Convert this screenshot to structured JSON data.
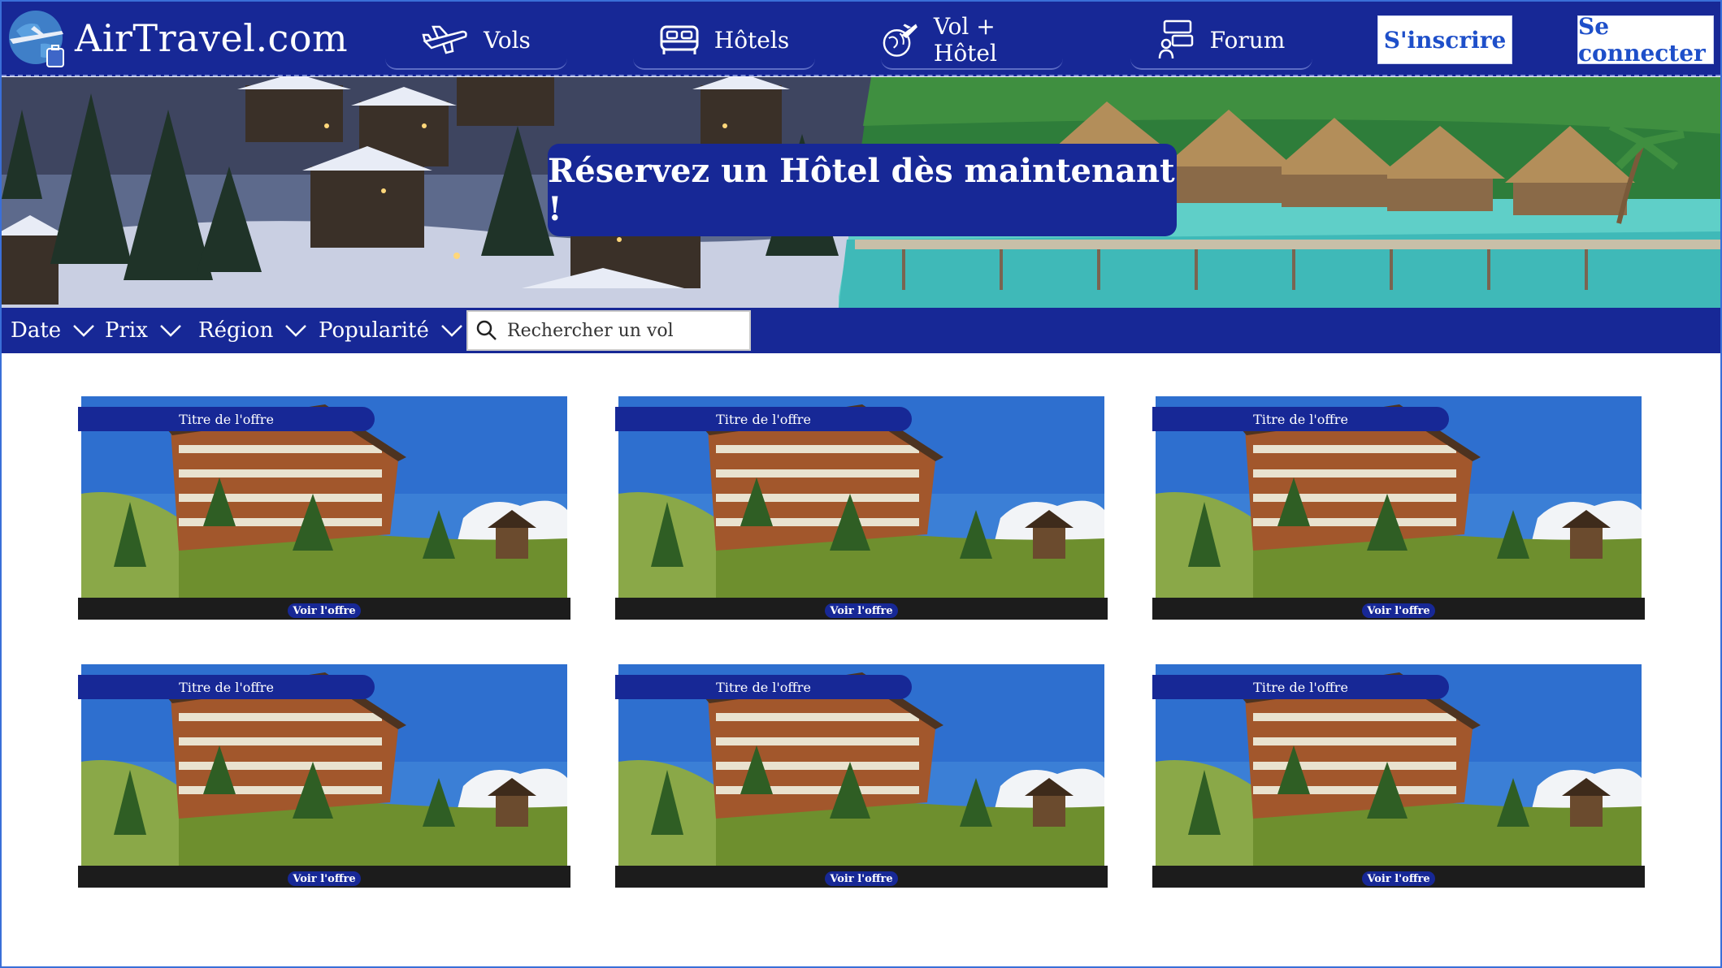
{
  "header": {
    "brand": "AirTravel.com",
    "nav": [
      {
        "label": "Vols",
        "icon": "plane-icon"
      },
      {
        "label": "Hôtels",
        "icon": "bed-icon"
      },
      {
        "label": "Vol + Hôtel",
        "icon": "globe-plane-icon"
      },
      {
        "label": "Forum",
        "icon": "forum-chat-icon"
      }
    ],
    "signup_label": "S'inscrire",
    "login_label": "Se connecter"
  },
  "hero": {
    "title": "Réservez un Hôtel dès maintenant !"
  },
  "filters": {
    "items": [
      {
        "label": "Date"
      },
      {
        "label": "Prix"
      },
      {
        "label": "Région"
      },
      {
        "label": "Popularité"
      }
    ],
    "search_placeholder": "Rechercher un vol"
  },
  "offers": [
    {
      "title": "Titre de l'offre",
      "button": "Voir l'offre"
    },
    {
      "title": "Titre de l'offre",
      "button": "Voir l'offre"
    },
    {
      "title": "Titre de l'offre",
      "button": "Voir l'offre"
    },
    {
      "title": "Titre de l'offre",
      "button": "Voir l'offre"
    },
    {
      "title": "Titre de l'offre",
      "button": "Voir l'offre"
    },
    {
      "title": "Titre de l'offre",
      "button": "Voir l'offre"
    }
  ],
  "colors": {
    "brand_blue": "#172896",
    "link_blue": "#1e4fc9",
    "card_footer": "#1c1c1c"
  }
}
